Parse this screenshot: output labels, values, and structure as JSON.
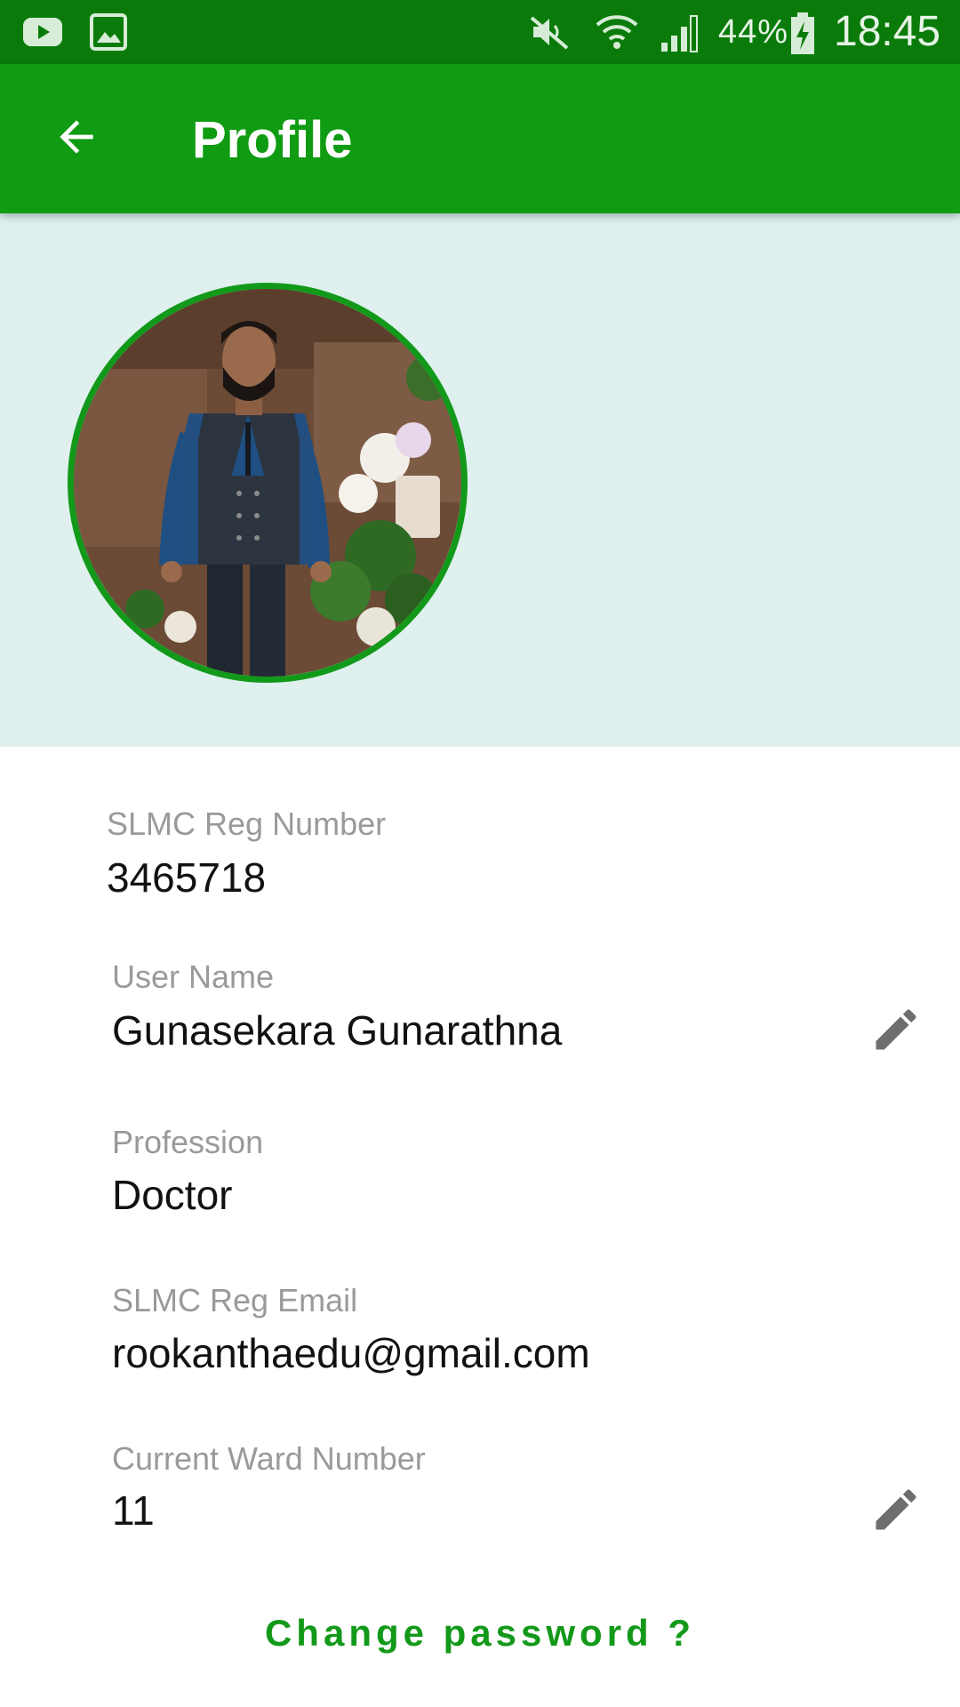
{
  "status_bar": {
    "battery_percent": "44%",
    "time": "18:45",
    "icons": [
      "youtube-icon",
      "gallery-icon",
      "mute-icon",
      "wifi-icon",
      "signal-icon",
      "battery-charging-icon"
    ]
  },
  "app_bar": {
    "title": "Profile",
    "back_icon": "arrow-back-icon"
  },
  "profile": {
    "fields": [
      {
        "label": "SLMC Reg Number",
        "value": "3465718",
        "editable": false
      },
      {
        "label": "User Name",
        "value": "Gunasekara Gunarathna",
        "editable": true
      },
      {
        "label": "Profession",
        "value": "Doctor",
        "editable": false
      },
      {
        "label": "SLMC Reg Email",
        "value": "rookanthaedu@gmail.com",
        "editable": false
      },
      {
        "label": "Current Ward Number",
        "value": "11",
        "editable": true
      }
    ],
    "edit_icon": "pencil-icon"
  },
  "actions": {
    "change_password_label": "Change password ?"
  },
  "colors": {
    "status_bar": "#0a7b0a",
    "app_bar": "#0f9b12",
    "header_bg": "#dff0ef",
    "accent": "#13991a",
    "label": "#9a9a9a",
    "value": "#111111"
  }
}
